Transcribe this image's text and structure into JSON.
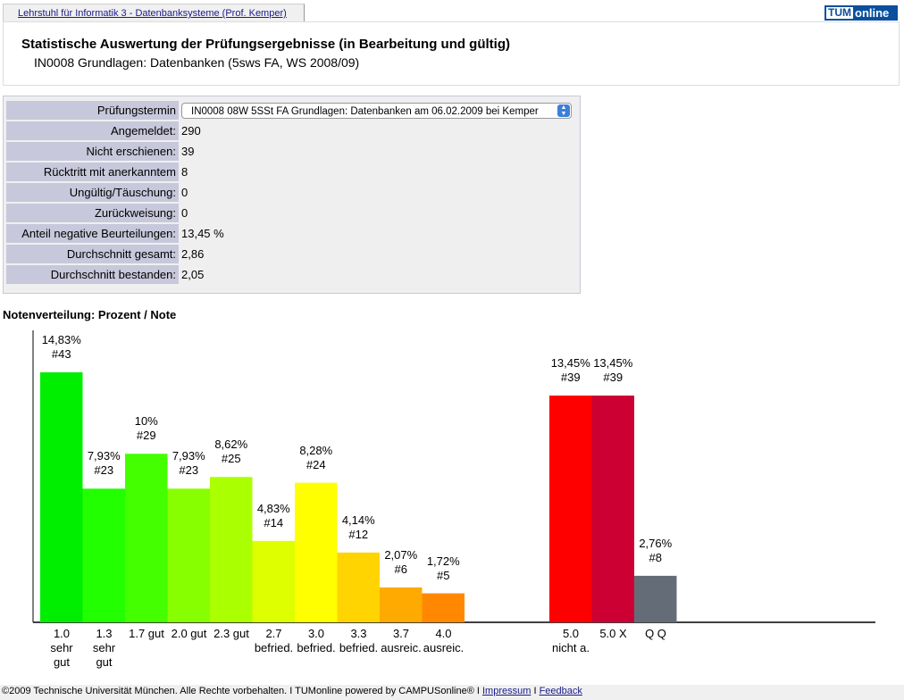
{
  "tab": {
    "label": "Lehrstuhl für Informatik 3 - Datenbanksysteme (Prof. Kemper)"
  },
  "logo": {
    "text": "TUMonline",
    "tum": "TUM",
    "online": "online"
  },
  "header": {
    "title": "Statistische Auswertung der Prüfungsergebnisse (in Bearbeitung und gültig)",
    "subtitle": "IN0008 Grundlagen: Datenbanken (5sws FA, WS 2008/09)"
  },
  "form": {
    "pruefungstermin_label": "Prüfungstermin",
    "pruefungstermin_value": "IN0008 08W 5SSt FA Grundlagen: Datenbanken am 06.02.2009 bei Kemper",
    "rows": [
      {
        "label": "Angemeldet:",
        "value": "290"
      },
      {
        "label": "Nicht erschienen:",
        "value": "39"
      },
      {
        "label": "Rücktritt mit anerkanntem Grund:",
        "value": "8"
      },
      {
        "label": "Ungültig/Täuschung:",
        "value": "0"
      },
      {
        "label": "Zurückweisung:",
        "value": "0"
      },
      {
        "label": "Anteil negative Beurteilungen:",
        "value": "13,45 %"
      },
      {
        "label": "Durchschnitt gesamt:",
        "value": "2,86"
      },
      {
        "label": "Durchschnitt bestanden:",
        "value": "2,05"
      }
    ]
  },
  "chart_data": {
    "type": "bar",
    "title": "Notenverteilung: Prozent / Note",
    "categories": [
      "1.0\nsehr\ngut",
      "1.3\nsehr\ngut",
      "1.7 gut",
      "2.0 gut",
      "2.3 gut",
      "2.7\nbefried.",
      "3.0\nbefried.",
      "3.3\nbefried.",
      "3.7\nausreic.",
      "4.0\nausreic.",
      "5.0\nnicht a.",
      "5.0 X",
      "Q Q"
    ],
    "values": [
      14.83,
      7.93,
      10,
      7.93,
      8.62,
      4.83,
      8.28,
      4.14,
      2.07,
      1.72,
      13.45,
      13.45,
      2.76
    ],
    "value_labels": [
      "14,83%",
      "7,93%",
      "10%",
      "7,93%",
      "8,62%",
      "4,83%",
      "8,28%",
      "4,14%",
      "2,07%",
      "1,72%",
      "13,45%",
      "13,45%",
      "2,76%"
    ],
    "counts": [
      "#43",
      "#23",
      "#29",
      "#23",
      "#25",
      "#14",
      "#24",
      "#12",
      "#6",
      "#5",
      "#39",
      "#39",
      "#8"
    ],
    "colors": [
      "#00ee00",
      "#22ff00",
      "#44ff00",
      "#88ff00",
      "#aaff00",
      "#ddff00",
      "#ffff00",
      "#ffd400",
      "#ffaa00",
      "#ff8800",
      "#ff0000",
      "#cc0033",
      "#646d77"
    ],
    "ylim": [
      0,
      15
    ],
    "grid": false
  },
  "footer": {
    "text": "©2009 Technische Universität München. Alle Rechte vorbehalten. I TUMonline powered by CAMPUSonline® I ",
    "impressum": "Impressum",
    "sep": " I ",
    "feedback": "Feedback"
  }
}
